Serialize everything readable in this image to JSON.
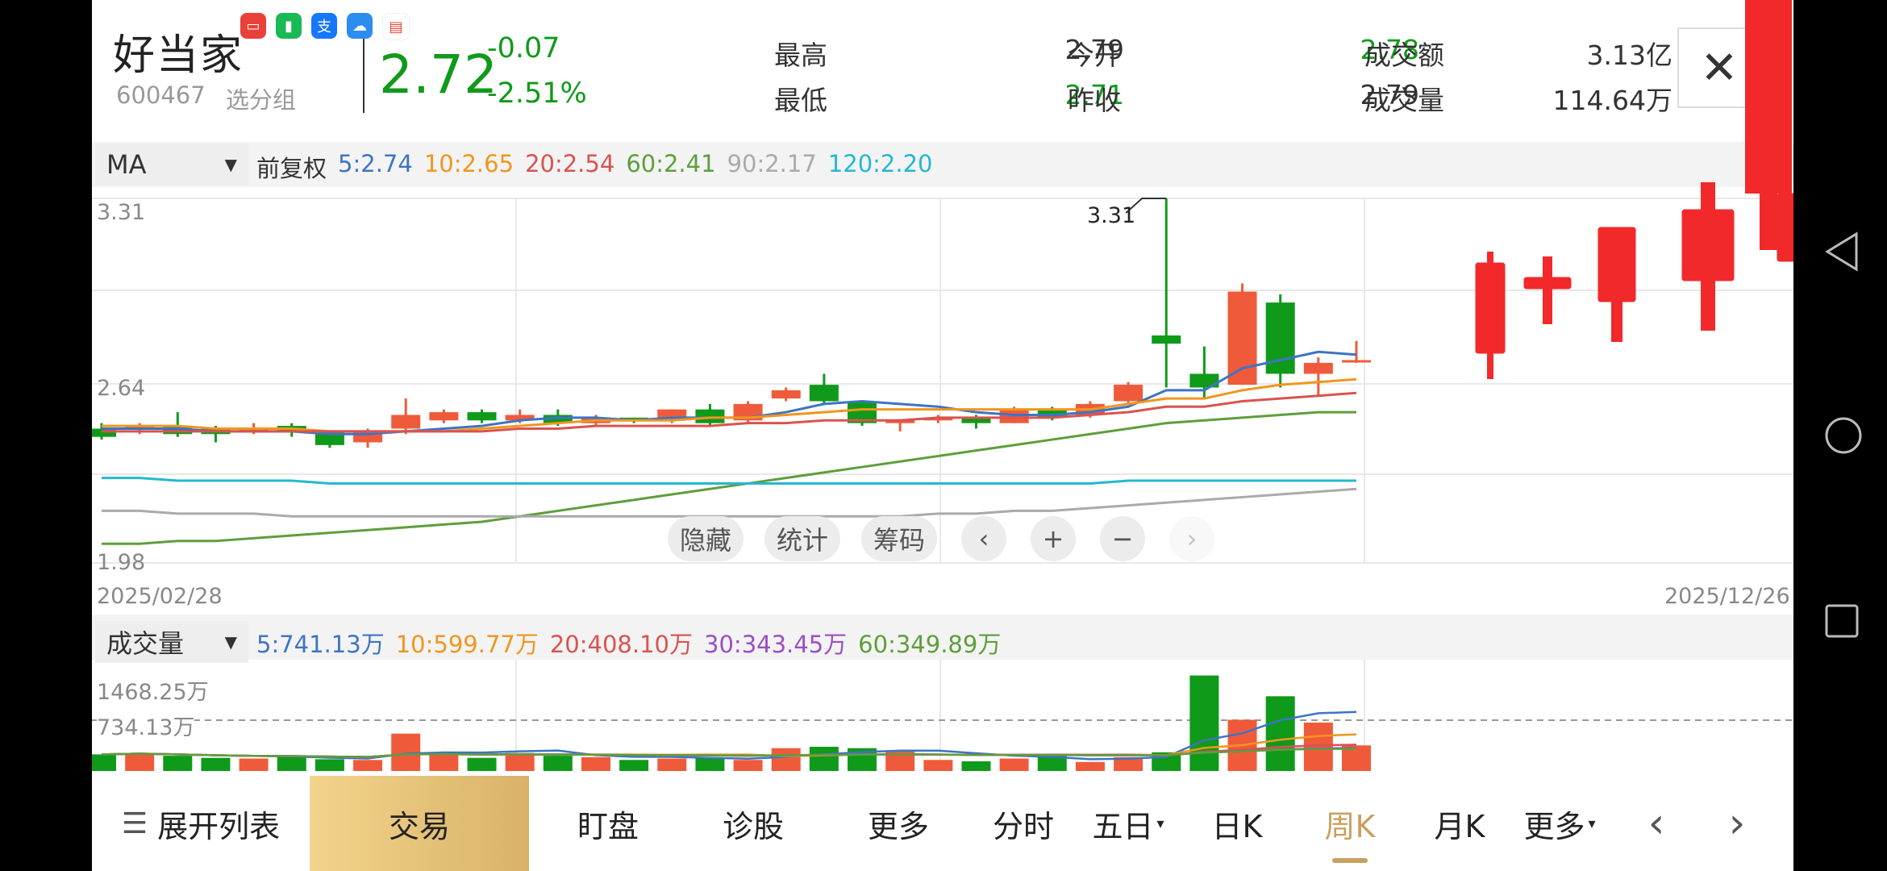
{
  "stock": {
    "name": "好当家",
    "code": "600467",
    "group_label": "选分组",
    "price": "2.72",
    "change": "-0.07",
    "change_pct": "-2.51%"
  },
  "quote": {
    "high_label": "最高",
    "high": "2.79",
    "low_label": "最低",
    "low": "2.71",
    "open_label": "今开",
    "open": "2.78",
    "prev_close_label": "昨收",
    "prev_close": "2.79",
    "amount_label": "成交额",
    "amount": "3.13亿",
    "volume_label": "成交量",
    "volume": "114.64万"
  },
  "close_label": "✕",
  "ma": {
    "selector": "MA",
    "adjust_label": "前复权",
    "items": [
      {
        "text": "5:2.74",
        "color": "#3d74c4"
      },
      {
        "text": "10:2.65",
        "color": "#f0961e"
      },
      {
        "text": "20:2.54",
        "color": "#d9534f"
      },
      {
        "text": "60:2.41",
        "color": "#5e9e3c"
      },
      {
        "text": "90:2.17",
        "color": "#aaaaaa"
      },
      {
        "text": "120:2.20",
        "color": "#23b8d0"
      }
    ]
  },
  "price_axis": {
    "top": "3.31",
    "mid": "2.64",
    "bottom": "1.98",
    "peak_label": "3.31",
    "date_start": "2025/02/28",
    "date_end": "2025/12/26"
  },
  "chart_controls": {
    "hide": "隐藏",
    "stats": "统计",
    "chips": "筹码",
    "prev": "‹",
    "zoom_in": "+",
    "zoom_out": "−",
    "next": "›"
  },
  "volume": {
    "selector": "成交量",
    "items": [
      {
        "text": "5:741.13万",
        "color": "#3d74c4"
      },
      {
        "text": "10:599.77万",
        "color": "#f0961e"
      },
      {
        "text": "20:408.10万",
        "color": "#d9534f"
      },
      {
        "text": "30:343.45万",
        "color": "#9b4fc4"
      },
      {
        "text": "60:349.89万",
        "color": "#5e9e3c"
      }
    ],
    "axis_top": "1468.25万",
    "axis_mid": "734.13万"
  },
  "tabs": {
    "expand": "展开列表",
    "trade": "交易",
    "watch": "盯盘",
    "diagnose": "诊股",
    "more1": "更多",
    "intraday": "分时",
    "five_day": "五日",
    "day_k": "日K",
    "week_k": "周K",
    "month_k": "月K",
    "more2": "更多",
    "prev": "‹",
    "next": "›"
  },
  "colors": {
    "up": "#ef5b3a",
    "down": "#0f9a1a",
    "bg": "#ffffff",
    "active_tab": "#c9a060"
  },
  "chart_data": {
    "type": "candlestick",
    "x_start": "2025/02/28",
    "x_end": "2025/12/26",
    "y_range": [
      1.98,
      3.31
    ],
    "candles": [
      {
        "o": 2.47,
        "h": 2.49,
        "l": 2.43,
        "c": 2.44
      },
      {
        "o": 2.47,
        "h": 2.49,
        "l": 2.45,
        "c": 2.48
      },
      {
        "o": 2.48,
        "h": 2.53,
        "l": 2.44,
        "c": 2.45
      },
      {
        "o": 2.47,
        "h": 2.48,
        "l": 2.42,
        "c": 2.45
      },
      {
        "o": 2.46,
        "h": 2.49,
        "l": 2.45,
        "c": 2.47
      },
      {
        "o": 2.48,
        "h": 2.49,
        "l": 2.44,
        "c": 2.46
      },
      {
        "o": 2.46,
        "h": 2.46,
        "l": 2.4,
        "c": 2.41
      },
      {
        "o": 2.42,
        "h": 2.47,
        "l": 2.4,
        "c": 2.46
      },
      {
        "o": 2.47,
        "h": 2.58,
        "l": 2.45,
        "c": 2.52
      },
      {
        "o": 2.5,
        "h": 2.54,
        "l": 2.49,
        "c": 2.53
      },
      {
        "o": 2.53,
        "h": 2.54,
        "l": 2.49,
        "c": 2.5
      },
      {
        "o": 2.5,
        "h": 2.54,
        "l": 2.49,
        "c": 2.52
      },
      {
        "o": 2.52,
        "h": 2.54,
        "l": 2.48,
        "c": 2.49
      },
      {
        "o": 2.49,
        "h": 2.52,
        "l": 2.48,
        "c": 2.51
      },
      {
        "o": 2.51,
        "h": 2.51,
        "l": 2.49,
        "c": 2.5
      },
      {
        "o": 2.5,
        "h": 2.54,
        "l": 2.49,
        "c": 2.54
      },
      {
        "o": 2.54,
        "h": 2.56,
        "l": 2.48,
        "c": 2.49
      },
      {
        "o": 2.5,
        "h": 2.57,
        "l": 2.49,
        "c": 2.56
      },
      {
        "o": 2.58,
        "h": 2.62,
        "l": 2.57,
        "c": 2.61
      },
      {
        "o": 2.63,
        "h": 2.67,
        "l": 2.56,
        "c": 2.57
      },
      {
        "o": 2.57,
        "h": 2.57,
        "l": 2.48,
        "c": 2.49
      },
      {
        "o": 2.49,
        "h": 2.5,
        "l": 2.46,
        "c": 2.5
      },
      {
        "o": 2.5,
        "h": 2.52,
        "l": 2.49,
        "c": 2.51
      },
      {
        "o": 2.51,
        "h": 2.52,
        "l": 2.47,
        "c": 2.49
      },
      {
        "o": 2.49,
        "h": 2.55,
        "l": 2.49,
        "c": 2.54
      },
      {
        "o": 2.54,
        "h": 2.55,
        "l": 2.5,
        "c": 2.51
      },
      {
        "o": 2.52,
        "h": 2.57,
        "l": 2.51,
        "c": 2.56
      },
      {
        "o": 2.57,
        "h": 2.64,
        "l": 2.56,
        "c": 2.63
      },
      {
        "o": 2.81,
        "h": 3.31,
        "l": 2.62,
        "c": 2.78
      },
      {
        "o": 2.67,
        "h": 2.77,
        "l": 2.58,
        "c": 2.62
      },
      {
        "o": 2.63,
        "h": 3.0,
        "l": 2.63,
        "c": 2.97
      },
      {
        "o": 2.93,
        "h": 2.96,
        "l": 2.62,
        "c": 2.67
      },
      {
        "o": 2.67,
        "h": 2.73,
        "l": 2.59,
        "c": 2.71
      },
      {
        "o": 2.72,
        "h": 2.79,
        "l": 2.71,
        "c": 2.72
      }
    ],
    "ma": [
      {
        "name": "5",
        "color": "#3d74c4",
        "values": [
          2.47,
          2.47,
          2.47,
          2.46,
          2.46,
          2.46,
          2.45,
          2.45,
          2.46,
          2.47,
          2.48,
          2.5,
          2.51,
          2.51,
          2.5,
          2.51,
          2.51,
          2.51,
          2.53,
          2.56,
          2.57,
          2.56,
          2.55,
          2.53,
          2.52,
          2.52,
          2.53,
          2.55,
          2.61,
          2.61,
          2.69,
          2.72,
          2.75,
          2.74
        ]
      },
      {
        "name": "10",
        "color": "#f0961e",
        "values": [
          2.48,
          2.48,
          2.48,
          2.47,
          2.47,
          2.47,
          2.46,
          2.46,
          2.46,
          2.46,
          2.47,
          2.48,
          2.49,
          2.5,
          2.5,
          2.5,
          2.51,
          2.51,
          2.52,
          2.53,
          2.54,
          2.54,
          2.54,
          2.54,
          2.54,
          2.54,
          2.54,
          2.56,
          2.58,
          2.58,
          2.61,
          2.63,
          2.64,
          2.65
        ]
      },
      {
        "name": "20",
        "color": "#d9534f",
        "values": [
          2.46,
          2.46,
          2.46,
          2.46,
          2.46,
          2.46,
          2.46,
          2.46,
          2.46,
          2.46,
          2.46,
          2.47,
          2.47,
          2.48,
          2.48,
          2.48,
          2.48,
          2.49,
          2.49,
          2.5,
          2.5,
          2.5,
          2.51,
          2.51,
          2.51,
          2.51,
          2.52,
          2.53,
          2.55,
          2.55,
          2.57,
          2.58,
          2.59,
          2.6
        ]
      },
      {
        "name": "60",
        "color": "#5e9e3c",
        "values": [
          2.05,
          2.05,
          2.06,
          2.06,
          2.07,
          2.08,
          2.09,
          2.1,
          2.11,
          2.12,
          2.13,
          2.15,
          2.17,
          2.19,
          2.21,
          2.23,
          2.25,
          2.27,
          2.29,
          2.31,
          2.33,
          2.35,
          2.37,
          2.39,
          2.41,
          2.43,
          2.45,
          2.47,
          2.49,
          2.5,
          2.51,
          2.52,
          2.53,
          2.53
        ]
      },
      {
        "name": "90",
        "color": "#aaaaaa",
        "values": [
          2.17,
          2.17,
          2.16,
          2.16,
          2.16,
          2.15,
          2.15,
          2.15,
          2.15,
          2.15,
          2.15,
          2.15,
          2.15,
          2.15,
          2.15,
          2.15,
          2.15,
          2.15,
          2.15,
          2.15,
          2.15,
          2.15,
          2.16,
          2.16,
          2.17,
          2.17,
          2.18,
          2.19,
          2.2,
          2.21,
          2.22,
          2.23,
          2.24,
          2.25
        ]
      },
      {
        "name": "120",
        "color": "#23b8d0",
        "values": [
          2.29,
          2.29,
          2.28,
          2.28,
          2.28,
          2.28,
          2.27,
          2.27,
          2.27,
          2.27,
          2.27,
          2.27,
          2.27,
          2.27,
          2.27,
          2.27,
          2.27,
          2.27,
          2.27,
          2.27,
          2.27,
          2.27,
          2.27,
          2.27,
          2.27,
          2.27,
          2.27,
          2.28,
          2.28,
          2.28,
          2.28,
          2.28,
          2.28,
          2.28
        ]
      }
    ],
    "volume_range": [
      0,
      1468.25
    ],
    "volumes": [
      240,
      260,
      220,
      190,
      180,
      200,
      170,
      160,
      540,
      270,
      190,
      260,
      220,
      200,
      160,
      180,
      190,
      160,
      330,
      350,
      330,
      300,
      160,
      140,
      180,
      240,
      130,
      200,
      270,
      1380,
      740,
      1080,
      700,
      370,
      590
    ]
  }
}
